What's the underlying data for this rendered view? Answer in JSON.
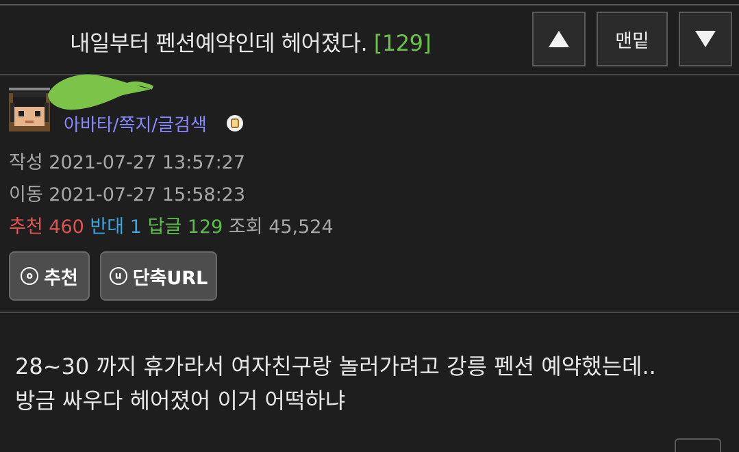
{
  "header": {
    "title": "내일부터 펜션예약인데 헤어졌다.",
    "comment_count": "[129]",
    "top_label": "맨밑"
  },
  "author": {
    "links": "아바타/쪽지/글검색"
  },
  "meta": {
    "created_label": "작성",
    "created": "2021-07-27 13:57:27",
    "moved_label": "이동",
    "moved": "2021-07-27 15:58:23"
  },
  "stats": {
    "recommend_label": "추천",
    "recommend": "460",
    "oppose_label": "반대",
    "oppose": "1",
    "reply_label": "답글",
    "reply": "129",
    "views_label": "조회",
    "views": "45,524"
  },
  "actions": {
    "recommend_icon_char": "o",
    "recommend_label": "추천",
    "url_icon_char": "u",
    "url_label": "단축URL"
  },
  "post": {
    "lines": [
      "28~30 까지 휴가라서 여자친구랑 놀러가려고 강릉 펜션 예약했는데..",
      "방금 싸우다 헤어졌어 이거 어떡하냐"
    ]
  },
  "colors": {
    "background": "#1e1e1e",
    "recommend": "#e05454",
    "oppose": "#3aa6de",
    "reply": "#5cbf4c",
    "link": "#8a8aff"
  }
}
